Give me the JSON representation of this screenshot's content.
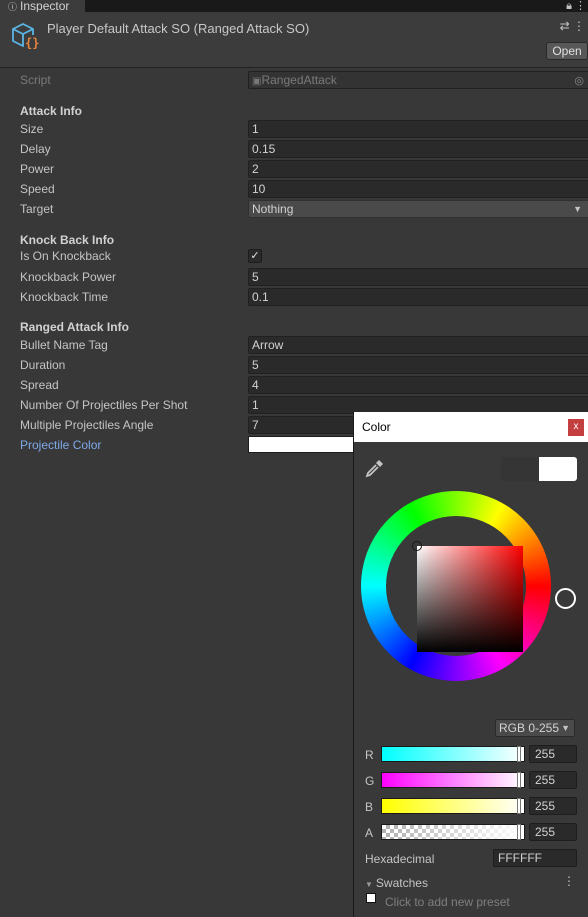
{
  "tab": {
    "label": "Inspector",
    "icon": "info-icon"
  },
  "header": {
    "title": "Player Default Attack SO (Ranged Attack SO)",
    "open_label": "Open",
    "icon": "scriptable-object-icon"
  },
  "script_row": {
    "label": "Script",
    "value": "RangedAttack"
  },
  "attack_info": {
    "heading": "Attack Info",
    "size": {
      "label": "Size",
      "value": "1"
    },
    "delay": {
      "label": "Delay",
      "value": "0.15"
    },
    "power": {
      "label": "Power",
      "value": "2"
    },
    "speed": {
      "label": "Speed",
      "value": "10"
    },
    "target": {
      "label": "Target",
      "value": "Nothing"
    }
  },
  "knock_back_info": {
    "heading": "Knock Back Info",
    "is_on": {
      "label": "Is On Knockback",
      "checked": true,
      "mark": "✓"
    },
    "power": {
      "label": "Knockback Power",
      "value": "5"
    },
    "time": {
      "label": "Knockback Time",
      "value": "0.1"
    }
  },
  "ranged_attack_info": {
    "heading": "Ranged Attack Info",
    "bullet_name_tag": {
      "label": "Bullet Name Tag",
      "value": "Arrow"
    },
    "duration": {
      "label": "Duration",
      "value": "5"
    },
    "spread": {
      "label": "Spread",
      "value": "4"
    },
    "projectiles": {
      "label": "Number Of Projectiles Per Shot",
      "value": "1"
    },
    "angle": {
      "label": "Multiple Projectiles Angle",
      "value": "7"
    },
    "color": {
      "label": "Projectile Color",
      "value_hex": "#FFFFFF"
    }
  },
  "color_picker": {
    "title": "Color",
    "close": "x",
    "mode": "RGB 0-255",
    "channels": {
      "r": {
        "label": "R",
        "value": "255"
      },
      "g": {
        "label": "G",
        "value": "255"
      },
      "b": {
        "label": "B",
        "value": "255"
      },
      "a": {
        "label": "A",
        "value": "255"
      }
    },
    "hex_label": "Hexadecimal",
    "hex_value": "FFFFFF",
    "swatches_label": "Swatches",
    "add_preset": "Click to add new preset",
    "current_color": "#FFFFFF",
    "previous_color": "#353535"
  },
  "colors": {
    "accent_label": "#7fa9e8",
    "close_bg": "#c44040",
    "panel_bg": "#383838"
  }
}
